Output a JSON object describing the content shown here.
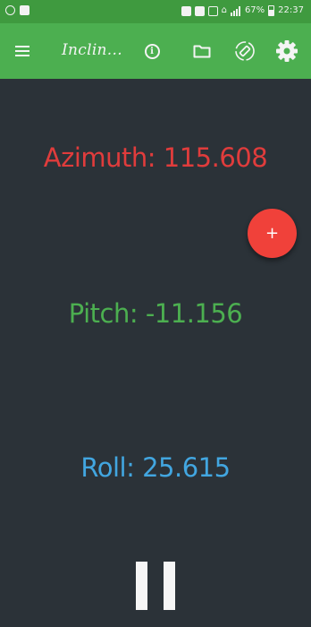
{
  "status_bar": {
    "battery_percent": "67%",
    "time": "22:37",
    "icons": [
      "alarm-icon",
      "gallery-icon",
      "notification-icon",
      "battery-saver-icon",
      "lock-icon",
      "cast-icon",
      "wifi-icon",
      "signal-icon",
      "battery-icon"
    ]
  },
  "toolbar": {
    "title": "Inclin...",
    "icons": [
      "menu-icon",
      "info-icon",
      "folder-icon",
      "screen-rotation-icon",
      "settings-icon"
    ],
    "background": "#4caf50"
  },
  "readings": {
    "azimuth": "Azimuth: 115.608",
    "pitch": "Pitch: -11.156",
    "roll": "Roll: 25.615"
  },
  "fab": {
    "symbol": "+",
    "color": "#f0413a"
  },
  "colors": {
    "background": "#2b3238",
    "azimuth": "#e03c3c",
    "pitch": "#4caf50",
    "roll": "#42a6e0"
  }
}
